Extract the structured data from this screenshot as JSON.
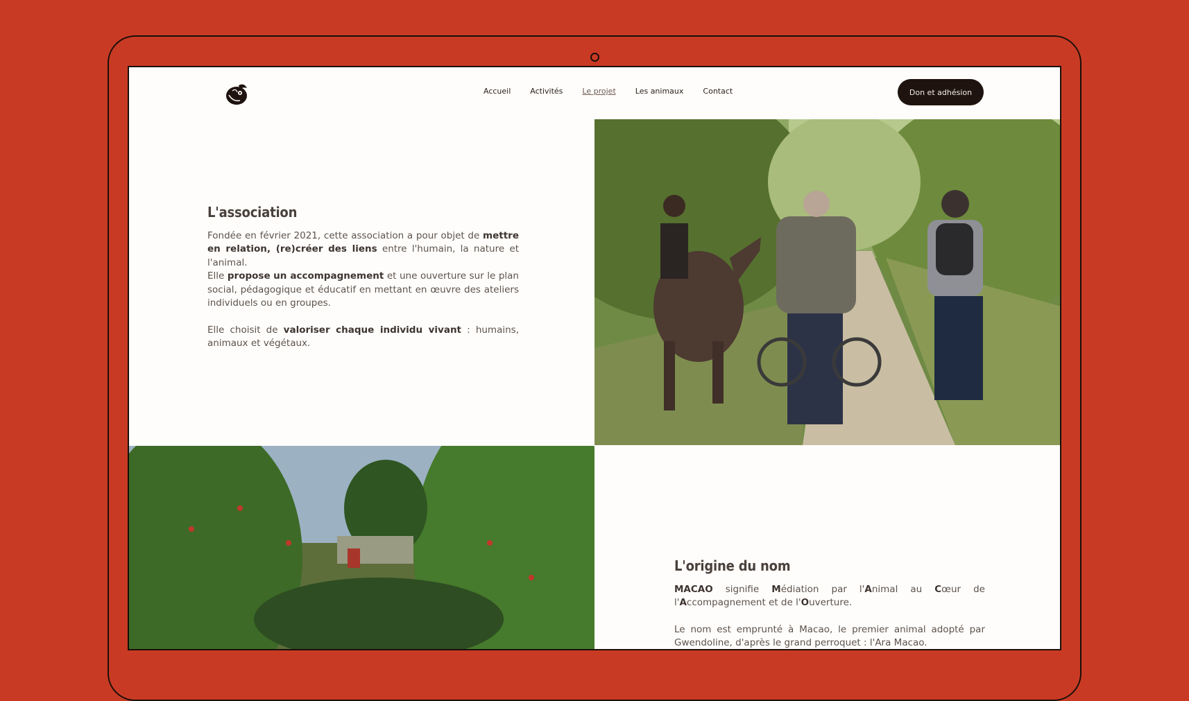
{
  "nav": {
    "items": [
      {
        "label": "Accueil"
      },
      {
        "label": "Activités"
      },
      {
        "label": "Le projet",
        "active": true
      },
      {
        "label": "Les animaux"
      },
      {
        "label": "Contact"
      }
    ],
    "cta_label": "Don et adhésion"
  },
  "association": {
    "title": "L'association",
    "p1": {
      "t1": "Fondée en février 2021, cette association a pour objet de ",
      "b1": "mettre en relation, (re)créer des liens",
      "t2": " entre l'humain, la nature et l'animal."
    },
    "p2": {
      "t1": "Elle ",
      "b1": "propose",
      "t2": " ",
      "b2": "un accompagnement",
      "t3": " et  une ouverture sur  le plan social, pédagogique et éducatif en mettant en œuvre des ateliers individuels ou en groupes."
    },
    "p3": {
      "t1": "Elle choisit de ",
      "b1": "valoriser chaque individu vivant",
      "t2": " : humains, animaux et végétaux."
    }
  },
  "origine": {
    "title": "L'origine du nom",
    "p1": {
      "b1": "MACAO",
      "t1": " signifie ",
      "b2": "M",
      "t2": "édiation par l'",
      "b3": "A",
      "t3": "nimal au ",
      "b4": "C",
      "t4": "œur de l'",
      "b5": "A",
      "t5": "ccompagnement et de l'",
      "b6": "O",
      "t6": "uverture."
    },
    "p2": "Le nom est emprunté à Macao, le premier animal adopté par Gwendoline, d'après le grand perroquet : l'Ara Macao."
  },
  "colors": {
    "background": "#c93a24",
    "page": "#fffdfb",
    "cta": "#1e130e",
    "text": "#5c524c"
  },
  "icons": {
    "logo": "macao-parrot-logo",
    "camera": "webcam-dot"
  }
}
